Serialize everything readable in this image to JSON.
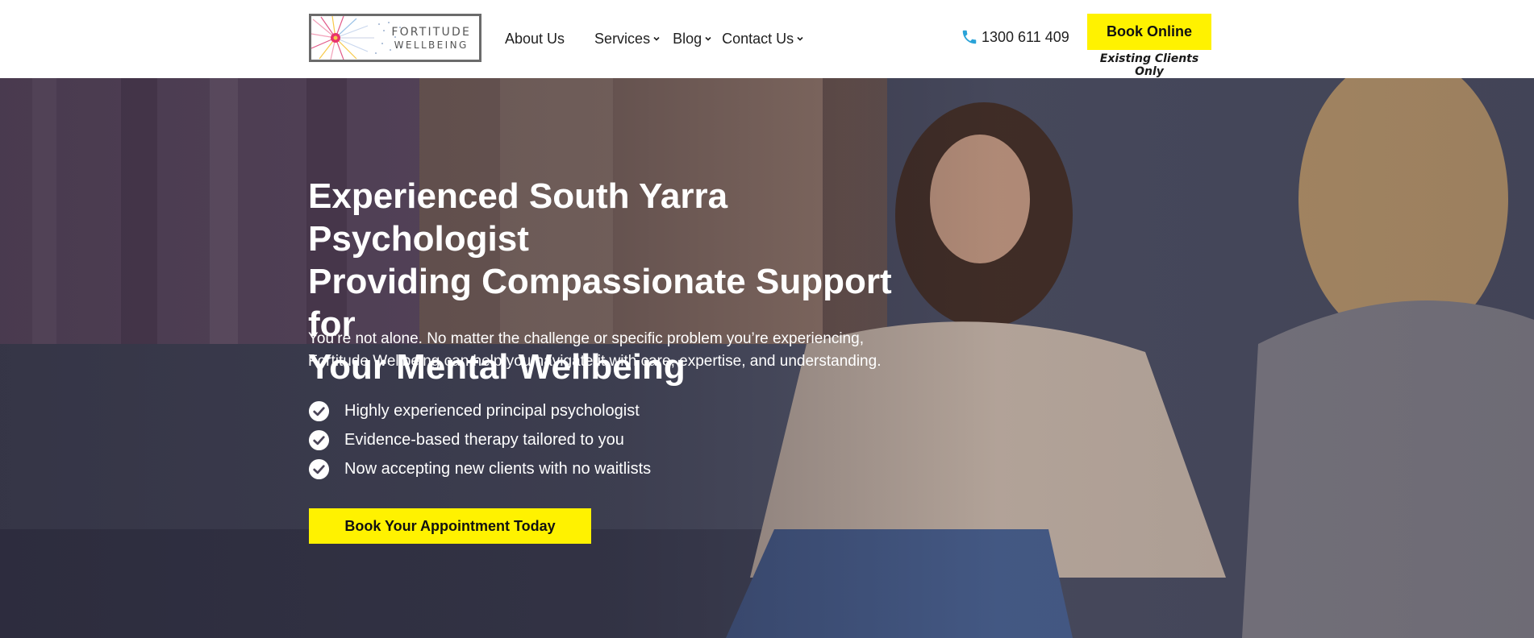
{
  "brand": {
    "logo_line1": "FORTITUDE",
    "logo_line2": "WELLBEING"
  },
  "nav": {
    "items": [
      {
        "label": "About Us",
        "has_dropdown": false
      },
      {
        "label": "Services",
        "has_dropdown": true
      },
      {
        "label": "Blog",
        "has_dropdown": true
      },
      {
        "label": "Contact Us",
        "has_dropdown": true
      }
    ]
  },
  "header": {
    "phone": "1300 611 409",
    "phone_icon": "phone-icon",
    "book_button": "Book Online",
    "book_note": "Existing Clients Only"
  },
  "hero": {
    "title_lines": [
      "Experienced South Yarra Psychologist",
      "Providing Compassionate Support for",
      "Your Mental Wellbeing"
    ],
    "subtitle_lines": [
      "You’re not alone. No matter the challenge or specific problem you’re experiencing,",
      "Fortitude Wellbeing can help you navigate it with care, expertise, and understanding."
    ],
    "checklist": [
      "Highly experienced principal psychologist",
      "Evidence-based therapy tailored to you",
      "Now accepting new clients with no waitlists"
    ],
    "check_icon": "check-circle-icon",
    "cta": "Book Your Appointment Today"
  },
  "colors": {
    "accent_yellow": "#fff200",
    "phone_icon_blue": "#2aa3d8",
    "text_dark": "#1f1f1f",
    "hero_text": "#ffffff"
  }
}
